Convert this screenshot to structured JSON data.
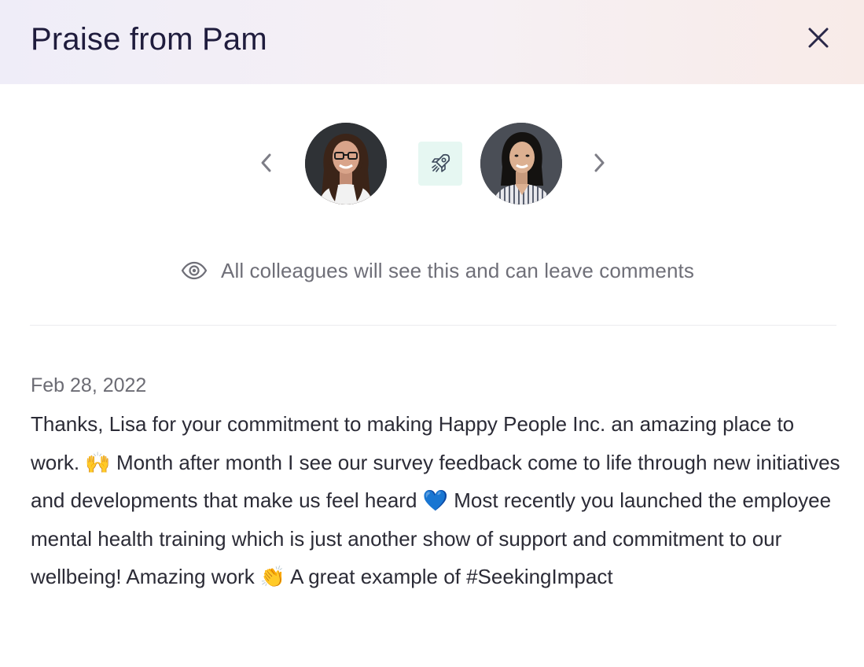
{
  "modal": {
    "title": "Praise from Pam",
    "close_icon": "close-icon"
  },
  "carousel": {
    "prev_icon": "chevron-left-icon",
    "next_icon": "chevron-right-icon",
    "badge_icon": "rocket-icon",
    "badge_bg_color": "#e6f7f2",
    "avatars": [
      {
        "role": "giver",
        "icon": "avatar"
      },
      {
        "role": "receiver",
        "icon": "avatar"
      }
    ]
  },
  "visibility": {
    "icon": "eye-icon",
    "text": "All colleagues will see this and can leave comments"
  },
  "praise": {
    "date": "Feb 28, 2022",
    "message": "Thanks, Lisa for your commitment to making Happy People Inc. an amazing place to work. 🙌 Month after month I see our survey feedback come to life through new initiatives and developments that make us feel heard 💙 Most recently you launched the employee mental health training which is just another show of support and commitment to our wellbeing! Amazing work 👏 A great example of #SeekingImpact"
  },
  "colors": {
    "title": "#1f1c3d",
    "header_gradient_start": "#efedf8",
    "header_gradient_end": "#f8ebe8",
    "muted_text": "#6f6f78"
  }
}
